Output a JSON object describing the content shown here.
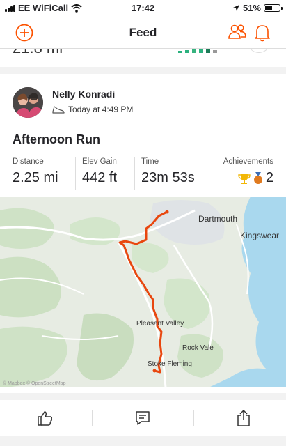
{
  "status_bar": {
    "carrier": "EE WiFiCall",
    "time": "17:42",
    "battery": "51%"
  },
  "nav": {
    "title": "Feed"
  },
  "previous_activity": {
    "partial_distance": "21.8 mi"
  },
  "activity": {
    "athlete_name": "Nelly Konradi",
    "timestamp": "Today at 4:49 PM",
    "title": "Afternoon Run",
    "stats": [
      {
        "label": "Distance",
        "value": "2.25 mi"
      },
      {
        "label": "Elev Gain",
        "value": "442 ft"
      },
      {
        "label": "Time",
        "value": "23m 53s"
      }
    ],
    "achievements": {
      "label": "Achievements",
      "count": "2"
    }
  },
  "map": {
    "places": [
      "Dartmouth",
      "Kingswear",
      "Pleasant Valley",
      "Rock Vale",
      "Stoke Fleming"
    ],
    "attribution": "© Mapbox © OpenStreetMap"
  },
  "colors": {
    "brand": "#fc5200",
    "route": "#e8470f",
    "water": "#a9d8ee",
    "land": "#e8ede2",
    "green": "#cfe3c4"
  },
  "icons": {
    "add": "add-circle-icon",
    "people": "people-icon",
    "bell": "bell-icon",
    "shoe": "shoe-icon",
    "kudos": "thumbs-up-icon",
    "comment": "comment-icon",
    "share": "share-icon"
  }
}
